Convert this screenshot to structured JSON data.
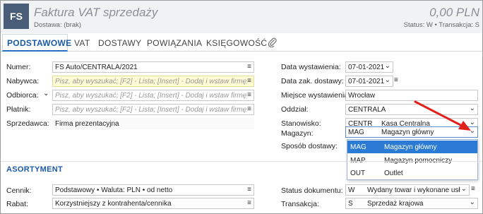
{
  "header": {
    "logo": "FS",
    "title": "Faktura VAT sprzedaży",
    "subtitle": "Dostawa: (brak)",
    "amount": "0,00 PLN",
    "status_line": "Status: W  •  Transakcja: S"
  },
  "tabs": [
    {
      "label": "PODSTAWOWE"
    },
    {
      "label": "VAT"
    },
    {
      "label": "DOSTAWY"
    },
    {
      "label": "POWIĄZANIA"
    },
    {
      "label": "KSIĘGOWOŚĆ"
    }
  ],
  "left": {
    "numer_label": "Numer:",
    "numer_value": "FS Auto/CENTRALA/2021",
    "nabywca_label": "Nabywca:",
    "nabywca_placeholder": "Pisz, aby wyszukać; [F2] - Lista; [Insert] - Dodaj i wstaw firmę;",
    "odbiorca_label": "Odbiorca:",
    "odbiorca_placeholder": "Pisz, aby wyszukać; [F2] - Lista; [Insert] - Dodaj i wstaw firmę;",
    "platnik_label": "Płatnik:",
    "platnik_placeholder": "Pisz, aby wyszukać; [F2] - Lista; [Insert] - Dodaj i wstaw firmę;",
    "sprzedawca_label": "Sprzedawca:",
    "sprzedawca_value": "Firma prezentacyjna"
  },
  "right": {
    "data_wyst_label": "Data wystawienia:",
    "data_wyst_value": "07-01-2021",
    "data_zak_label": "Data zak. dostawy:",
    "data_zak_value": "07-01-2021",
    "miejsce_label": "Miejsce wystawienia:",
    "miejsce_value": "Wrocław",
    "oddzial_label": "Oddział:",
    "oddzial_value": "CENTRALA",
    "stanowisko_label": "Stanowisko:",
    "stanowisko_code": "CENTR",
    "stanowisko_name": "Kasa Centralna",
    "magazyn_label": "Magazyn:",
    "magazyn_code": "MAG",
    "magazyn_name": "Magazyn główny",
    "sposob_label": "Sposób dostawy:"
  },
  "magazyn_dropdown": [
    {
      "code": "MAG",
      "name": "Magazyn główny",
      "selected": true
    },
    {
      "code": "MAP",
      "name": "Magazyn pomocniczy",
      "selected": false
    },
    {
      "code": "OUT",
      "name": "Outlet",
      "selected": false
    }
  ],
  "asortyment": {
    "section_title": "ASORTYMENT",
    "cennik_label": "Cennik:",
    "cennik_value": "Podstawowy • Waluta: PLN • od netto",
    "rabat_label": "Rabat:",
    "rabat_value": "Korzystniejszy z kontrahenta/cennika",
    "status_label": "Status dokumentu:",
    "status_code": "W",
    "status_name": "Wydany towar i wykonane usł",
    "transakcja_label": "Transakcja:",
    "transakcja_code": "S",
    "transakcja_name": "Sprzedaż krajowa"
  },
  "colors": {
    "accent": "#1b5aa4",
    "highlight": "#2b7bd4",
    "arrow": "#e0201a",
    "logo_bg": "#4a5d78"
  }
}
